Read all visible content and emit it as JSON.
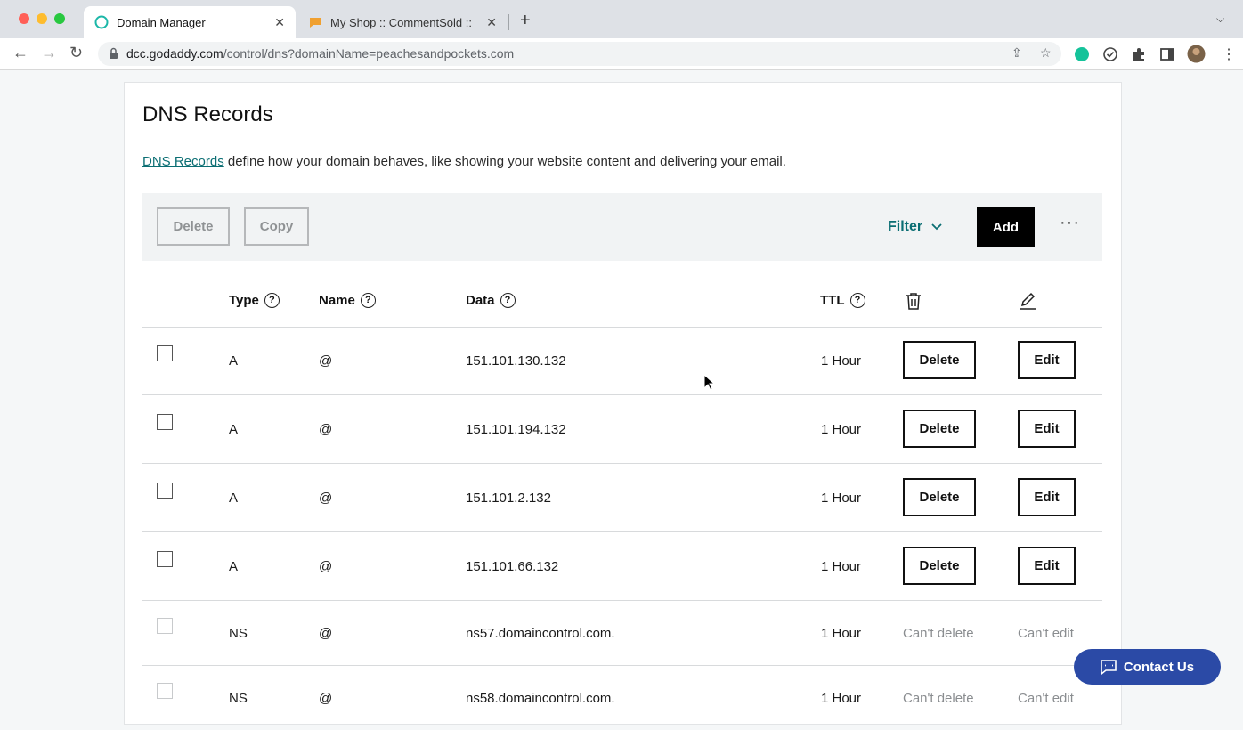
{
  "browser": {
    "tabs": [
      {
        "title": "Domain Manager",
        "active": true,
        "icon": "godaddy-icon"
      },
      {
        "title": "My Shop :: CommentSold ::",
        "active": false,
        "icon": "commentsold-icon"
      }
    ],
    "url_host": "dcc.godaddy.com",
    "url_path": "/control/dns?domainName=peachesandpockets.com"
  },
  "page": {
    "title": "DNS Records",
    "description_link": "DNS Records",
    "description_text": " define how your domain behaves, like showing your website content and delivering your email."
  },
  "toolbar": {
    "delete_label": "Delete",
    "copy_label": "Copy",
    "filter_label": "Filter",
    "add_label": "Add",
    "more_label": "···"
  },
  "table": {
    "headers": {
      "type": "Type",
      "name": "Name",
      "data": "Data",
      "ttl": "TTL"
    },
    "rows": [
      {
        "type": "A",
        "name": "@",
        "data": "151.101.130.132",
        "ttl": "1 Hour",
        "delete": "Delete",
        "edit": "Edit"
      },
      {
        "type": "A",
        "name": "@",
        "data": "151.101.194.132",
        "ttl": "1 Hour",
        "delete": "Delete",
        "edit": "Edit"
      },
      {
        "type": "A",
        "name": "@",
        "data": "151.101.2.132",
        "ttl": "1 Hour",
        "delete": "Delete",
        "edit": "Edit"
      },
      {
        "type": "A",
        "name": "@",
        "data": "151.101.66.132",
        "ttl": "1 Hour",
        "delete": "Delete",
        "edit": "Edit"
      },
      {
        "type": "NS",
        "name": "@",
        "data": "ns57.domaincontrol.com.",
        "ttl": "1 Hour",
        "delete": "Can't delete",
        "edit": "Can't edit"
      },
      {
        "type": "NS",
        "name": "@",
        "data": "ns58.domaincontrol.com.",
        "ttl": "1 Hour",
        "delete": "Can't delete",
        "edit": "Can't edit"
      }
    ]
  },
  "contact": {
    "label": "Contact Us"
  },
  "colors": {
    "accent": "#0b6e73",
    "contact_bg": "#2b4aa6"
  }
}
